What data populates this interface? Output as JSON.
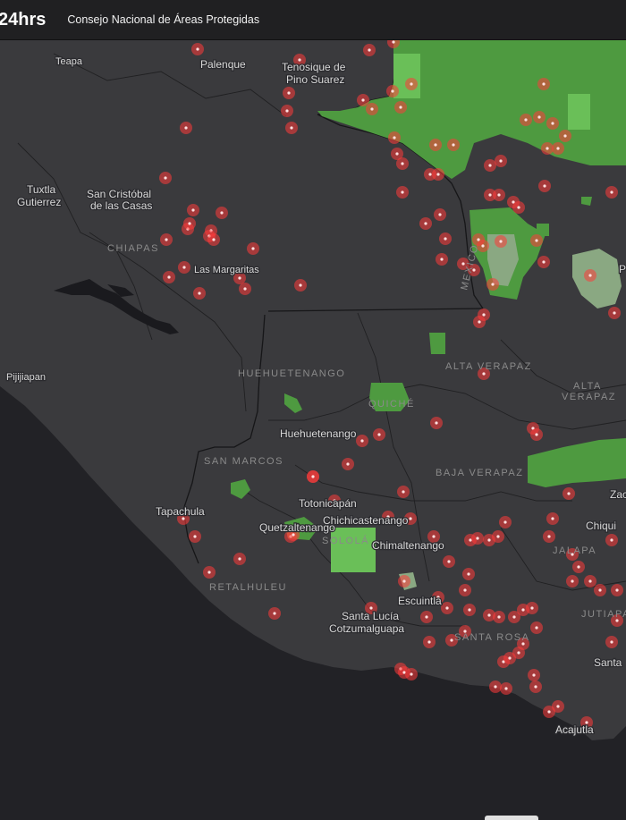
{
  "header": {
    "brand": "24hrs",
    "organization": "Consejo Nacional de Áreas Protegidas"
  },
  "map": {
    "colors": {
      "land": "#3a3a3d",
      "ocean": "#222226",
      "border": "#161618",
      "protected_area": "#4e9a40",
      "protected_area_light": "#8aa882",
      "hotspot": "#ff4a4a"
    },
    "city_labels": [
      "Teapa",
      "Palenque",
      "Tenosique de",
      "Pino Suarez",
      "Tuxtla",
      "Gutierrez",
      "San Cristóbal",
      "de las Casas",
      "Las Margaritas",
      "Pijijiapan",
      "Huehuetenango",
      "Tapachula",
      "Totonicapán",
      "Chichicastenango",
      "Quetzaltenango",
      "Chimaltenango",
      "Escuintla",
      "Santa Lucía",
      "Cotzumalguapa",
      "Acajutla",
      "Zac",
      "Chiqui",
      "Santa",
      "P"
    ],
    "region_labels": [
      "CHIAPAS",
      "MEXICO",
      "HUEHUETENANGO",
      "ALTA VERAPAZ",
      "ALTA",
      "VERAPAZ",
      "QUICHÉ",
      "SAN MARCOS",
      "BAJA VERAPAZ",
      "SOLOLÁ",
      "RETALHULEU",
      "JALAPA",
      "JUTIAPA",
      "SANTA ROSA"
    ]
  }
}
